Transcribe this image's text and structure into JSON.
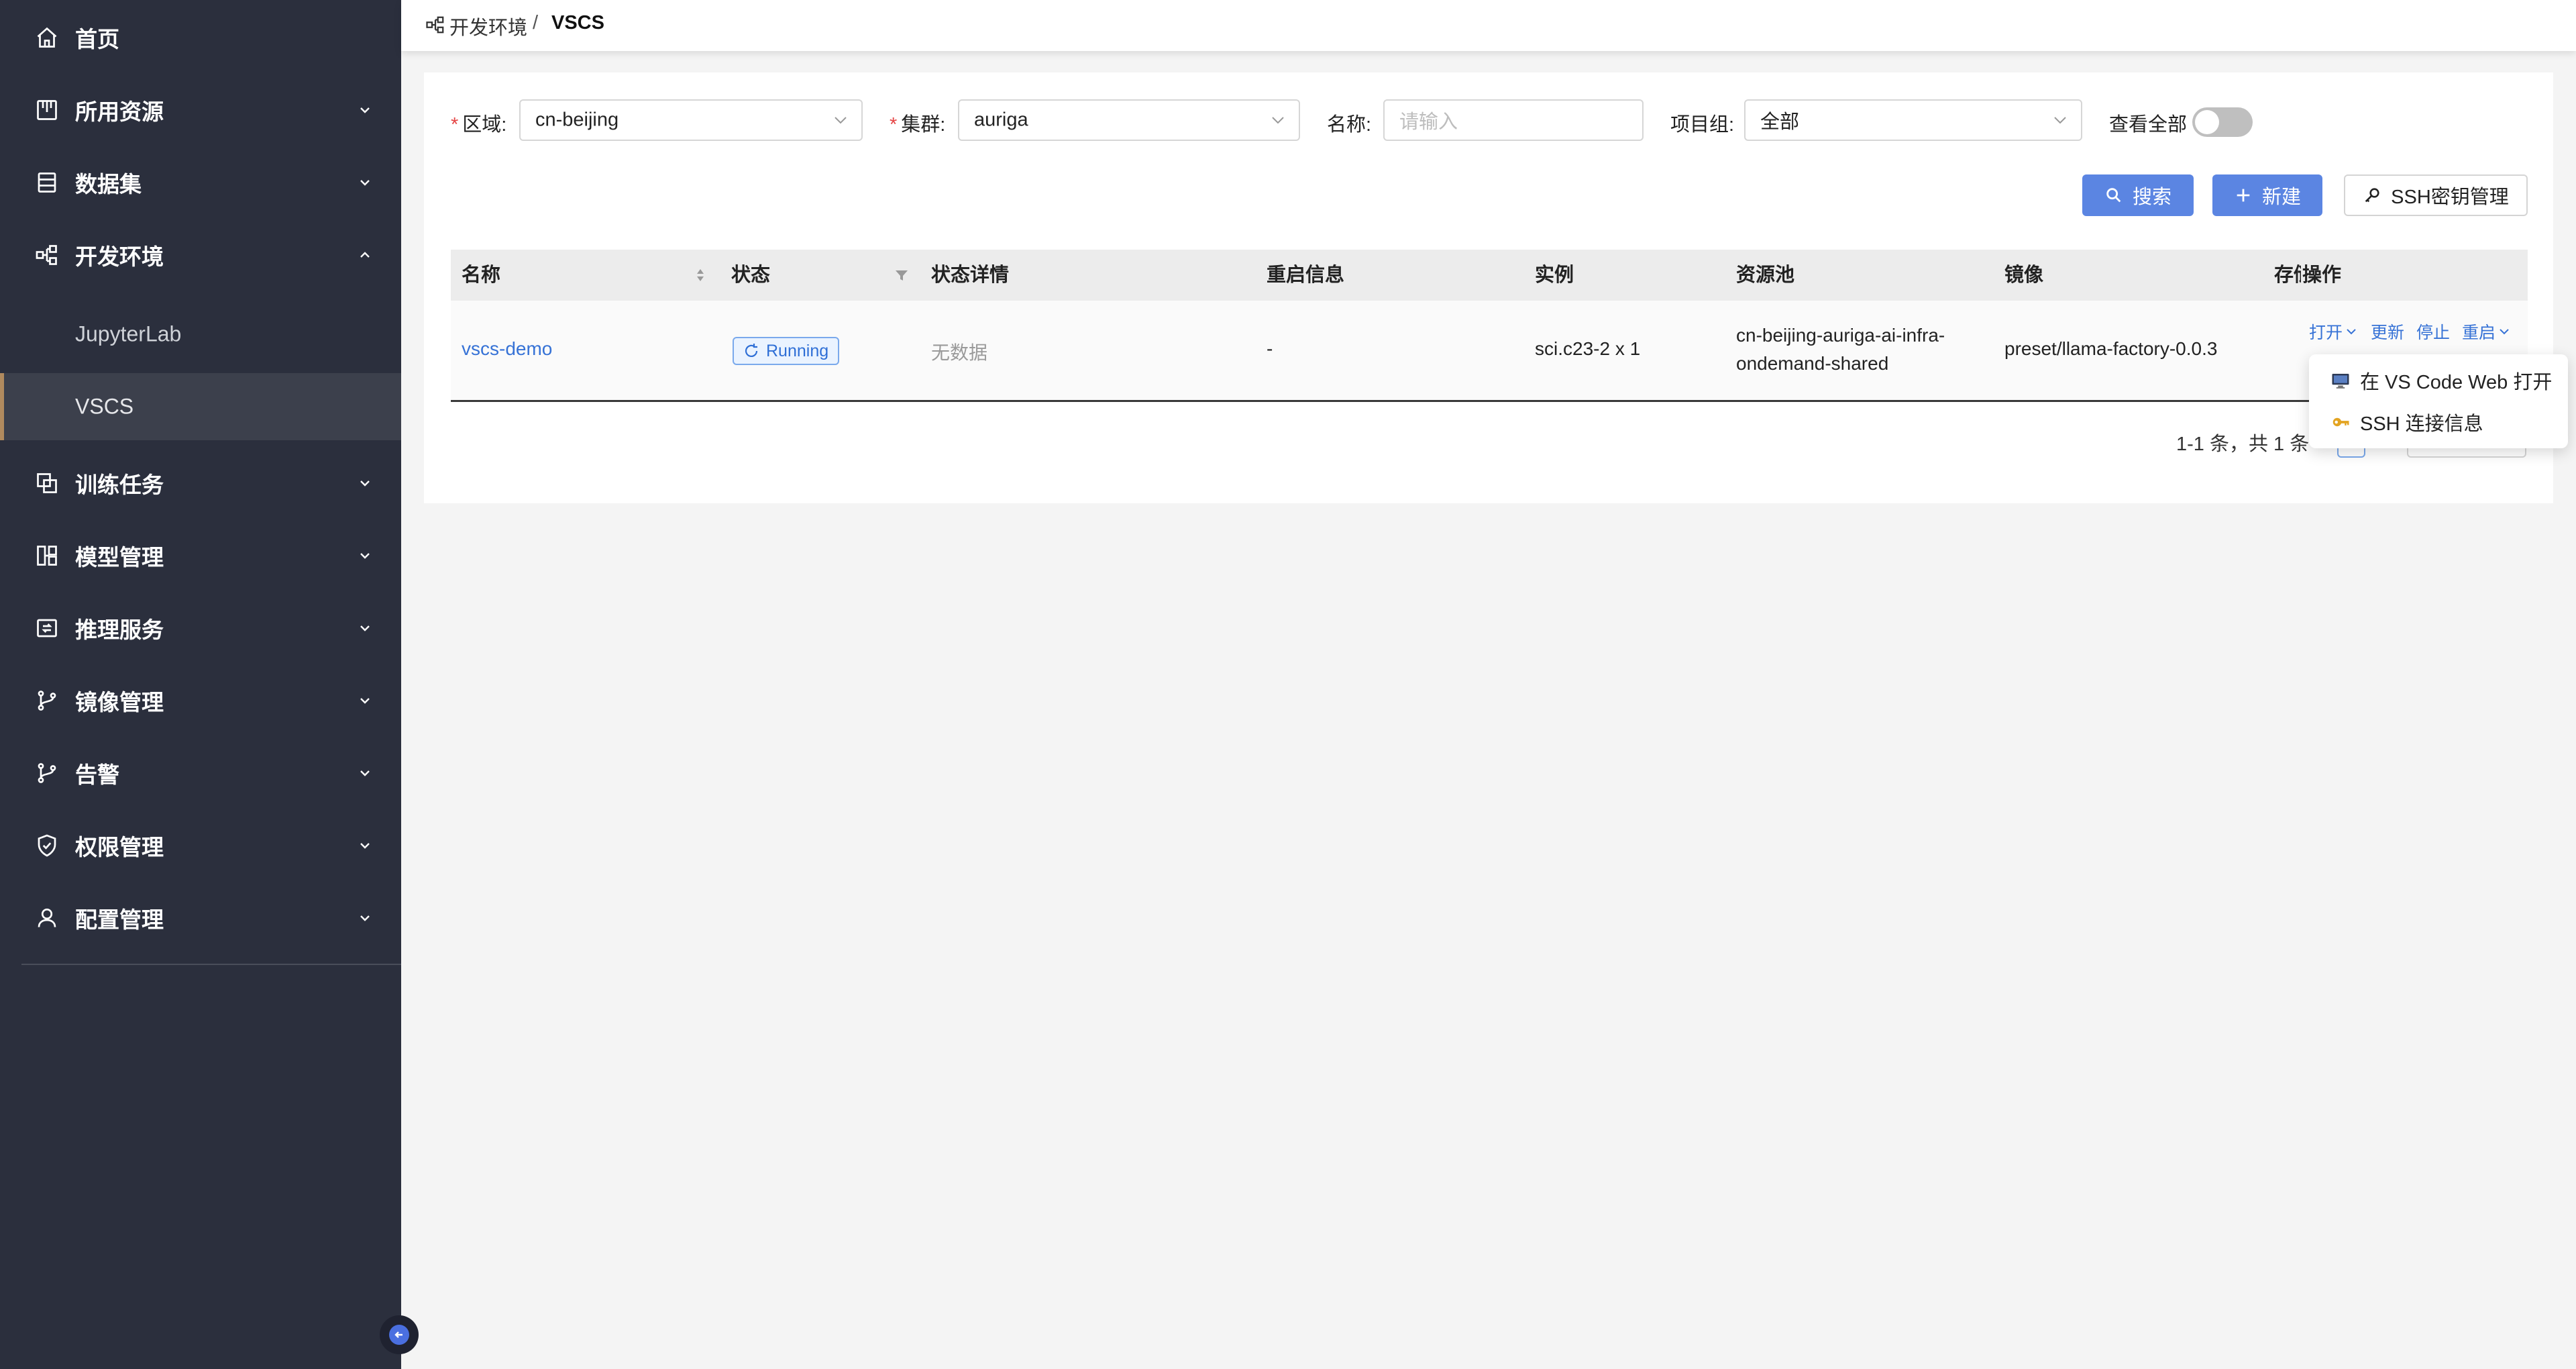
{
  "sidebar": {
    "items": [
      {
        "label": "首页",
        "icon": "home-icon"
      },
      {
        "label": "所用资源",
        "icon": "resource-icon"
      },
      {
        "label": "数据集",
        "icon": "dataset-icon"
      },
      {
        "label": "开发环境",
        "icon": "dev-env-icon"
      },
      {
        "label": "训练任务",
        "icon": "training-icon"
      },
      {
        "label": "模型管理",
        "icon": "model-icon"
      },
      {
        "label": "推理服务",
        "icon": "inference-icon"
      },
      {
        "label": "镜像管理",
        "icon": "image-branch-icon"
      },
      {
        "label": "告警",
        "icon": "alert-branch-icon"
      },
      {
        "label": "权限管理",
        "icon": "shield-icon"
      },
      {
        "label": "配置管理",
        "icon": "user-icon"
      }
    ],
    "sub_items": [
      {
        "label": "JupyterLab"
      },
      {
        "label": "VSCS",
        "active": true
      }
    ]
  },
  "breadcrumb": {
    "parent": "开发环境",
    "separator": "/",
    "current": "VSCS"
  },
  "filters": {
    "region": {
      "label": "区域:",
      "value": "cn-beijing",
      "required": true
    },
    "cluster": {
      "label": "集群:",
      "value": "auriga",
      "required": true
    },
    "name": {
      "label": "名称:",
      "placeholder": "请输入"
    },
    "project": {
      "label": "项目组:",
      "value": "全部"
    },
    "view_all": {
      "label": "查看全部",
      "on": false
    }
  },
  "buttons": {
    "search": "搜索",
    "create": "新建",
    "ssh_keys": "SSH密钥管理"
  },
  "table": {
    "columns": [
      "名称",
      "状态",
      "状态详情",
      "重启信息",
      "实例",
      "资源池",
      "镜像",
      "存储",
      "操作"
    ],
    "rows": [
      {
        "name": "vscs-demo",
        "status": "Running",
        "status_detail": "无数据",
        "restart_info": "-",
        "instance": "sci.c23-2 x 1",
        "pool_line1": "cn-beijing-auriga-ai-infra-",
        "pool_line2": "ondemand-shared",
        "image": "preset/llama-factory-0.0.3",
        "actions": {
          "open": "打开",
          "update": "更新",
          "stop": "停止",
          "restart": "重启"
        }
      }
    ]
  },
  "pagination": {
    "summary": "1-1 条，共 1 条"
  },
  "open_menu": {
    "items": [
      {
        "label": "在 VS Code Web 打开",
        "icon": "monitor-icon"
      },
      {
        "label": "SSH 连接信息",
        "icon": "key-icon"
      }
    ]
  },
  "colors": {
    "sidebar_bg": "#2b2f3d",
    "primary": "#5b85e2",
    "link": "#3672d6",
    "active_marker": "#b08a5e"
  }
}
